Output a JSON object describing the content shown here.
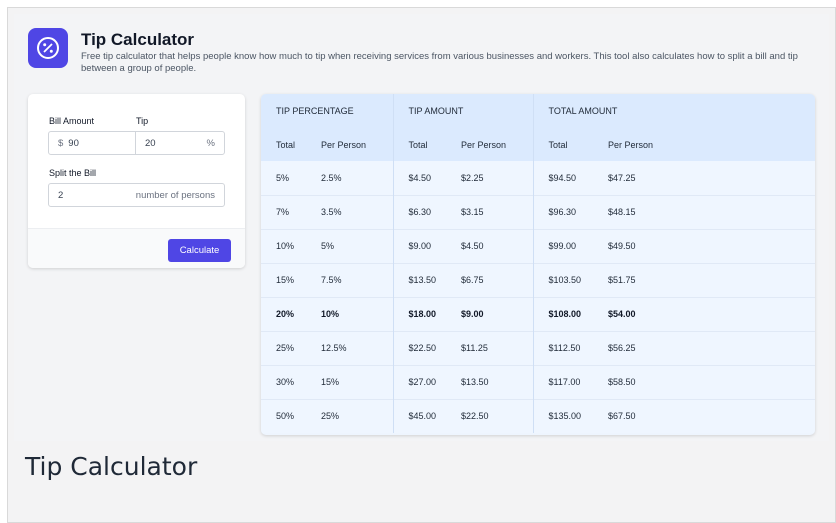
{
  "app": {
    "title": "Tip Calculator",
    "description": "Free tip calculator that helps people know how much to tip when receiving services from various businesses and workers. This tool also calculates how to split a bill and tip between a group of people.",
    "logo_icon": "percent-icon",
    "accent_color": "#4f46e5"
  },
  "form": {
    "bill_label": "Bill Amount",
    "bill_prefix": "$",
    "bill_value": "90",
    "tip_label": "Tip",
    "tip_value": "20",
    "tip_suffix": "%",
    "split_label": "Split the Bill",
    "split_value": "2",
    "split_suffix": "number of persons",
    "calculate_label": "Calculate"
  },
  "table": {
    "groups": [
      "TIP PERCENTAGE",
      "TIP AMOUNT",
      "TOTAL AMOUNT"
    ],
    "subheaders": [
      "Total",
      "Per Person",
      "Total",
      "Per Person",
      "Total",
      "Per Person"
    ],
    "highlighted_row": 4,
    "rows": [
      [
        "5%",
        "2.5%",
        "$4.50",
        "$2.25",
        "$94.50",
        "$47.25"
      ],
      [
        "7%",
        "3.5%",
        "$6.30",
        "$3.15",
        "$96.30",
        "$48.15"
      ],
      [
        "10%",
        "5%",
        "$9.00",
        "$4.50",
        "$99.00",
        "$49.50"
      ],
      [
        "15%",
        "7.5%",
        "$13.50",
        "$6.75",
        "$103.50",
        "$51.75"
      ],
      [
        "20%",
        "10%",
        "$18.00",
        "$9.00",
        "$108.00",
        "$54.00"
      ],
      [
        "25%",
        "12.5%",
        "$22.50",
        "$11.25",
        "$112.50",
        "$56.25"
      ],
      [
        "30%",
        "15%",
        "$27.00",
        "$13.50",
        "$117.00",
        "$58.50"
      ],
      [
        "50%",
        "25%",
        "$45.00",
        "$22.50",
        "$135.00",
        "$67.50"
      ]
    ]
  },
  "caption": "Tip Calculator"
}
